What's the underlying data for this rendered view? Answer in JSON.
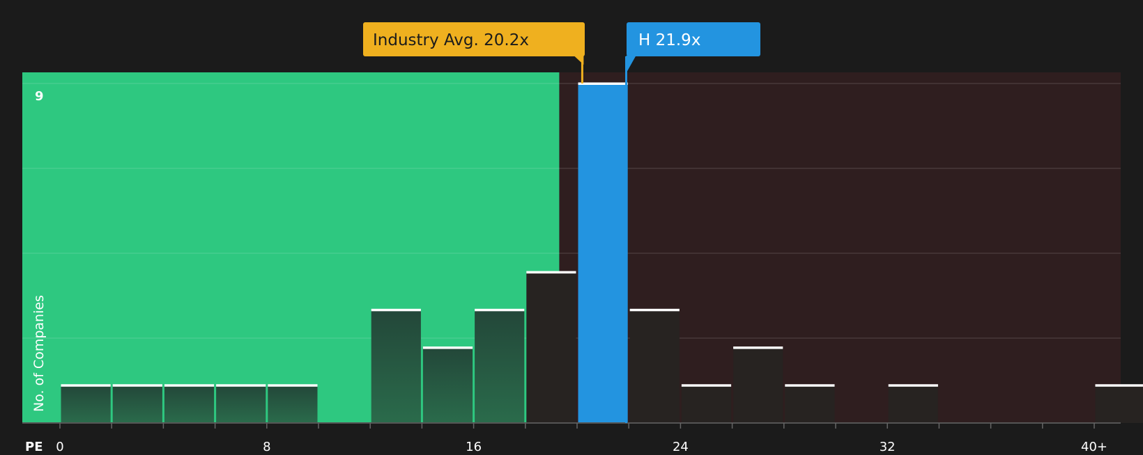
{
  "chart_data": {
    "type": "bar",
    "x_axis_label": "PE",
    "ylabel": "No. of Companies",
    "y_max_label": "9",
    "ylim": [
      0,
      9
    ],
    "xlim": [
      0,
      41
    ],
    "x_ticks": [
      {
        "value": 0,
        "label": "0"
      },
      {
        "value": 8,
        "label": "8"
      },
      {
        "value": 16,
        "label": "16"
      },
      {
        "value": 24,
        "label": "24"
      },
      {
        "value": 32,
        "label": "32"
      },
      {
        "value": 40,
        "label": "40+"
      }
    ],
    "bin_width": 2,
    "bins": [
      {
        "start": 0,
        "value": 1
      },
      {
        "start": 2,
        "value": 1
      },
      {
        "start": 4,
        "value": 1
      },
      {
        "start": 6,
        "value": 1
      },
      {
        "start": 8,
        "value": 1
      },
      {
        "start": 10,
        "value": 0
      },
      {
        "start": 12,
        "value": 3
      },
      {
        "start": 14,
        "value": 2
      },
      {
        "start": 16,
        "value": 3
      },
      {
        "start": 18,
        "value": 4
      },
      {
        "start": 20,
        "value": 9
      },
      {
        "start": 22,
        "value": 3
      },
      {
        "start": 24,
        "value": 1
      },
      {
        "start": 26,
        "value": 2
      },
      {
        "start": 28,
        "value": 1
      },
      {
        "start": 30,
        "value": 0
      },
      {
        "start": 32,
        "value": 1
      },
      {
        "start": 34,
        "value": 0
      },
      {
        "start": 36,
        "value": 0
      },
      {
        "start": 38,
        "value": 0
      },
      {
        "start": 40,
        "value": 1
      }
    ],
    "highlight_bin_start": 20,
    "industry_avg": {
      "label": "Industry Avg. 20.2x",
      "value": 20.2
    },
    "company": {
      "label": "H 21.9x",
      "value": 21.9
    },
    "colors": {
      "background": "#1b1b1b",
      "undervalued_zone": "#2ec880",
      "overvalued_zone": "#2f1e1f",
      "bar_green_top": "#234739",
      "bar_green_bottom": "#2a6b4b",
      "bar_dark": "#272321",
      "highlight_bar": "#2394e0",
      "industry_label": "#efb01f",
      "company_label": "#2394e0",
      "bar_cap": "#ffffff"
    }
  }
}
